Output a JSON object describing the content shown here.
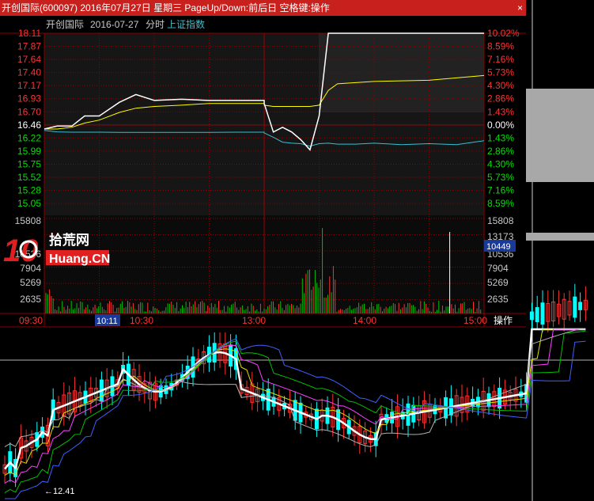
{
  "title_bar": {
    "text": "开创国际(600097) 2016年07月27日 星期三 PageUp/Down:前后日 空格键:操作",
    "close_glyph": "×"
  },
  "chart_header": {
    "stock": "开创国际",
    "date": "2016-07-27",
    "mode": "分时",
    "index_link": "上证指数"
  },
  "price_axis": {
    "left_labels": [
      "18.11",
      "17.87",
      "17.64",
      "17.40",
      "17.17",
      "16.93",
      "16.70",
      "16.46",
      "16.22",
      "15.99",
      "15.75",
      "15.52",
      "15.28",
      "15.05"
    ],
    "right_labels": [
      "10.02%",
      "8.59%",
      "7.16%",
      "5.73%",
      "4.30%",
      "2.86%",
      "1.43%",
      "0.00%",
      "1.43%",
      "2.86%",
      "4.30%",
      "5.73%",
      "7.16%",
      "8.59%"
    ]
  },
  "volume_axis": {
    "left_labels": [
      "15808",
      "10536",
      "7904",
      "5269",
      "2635"
    ],
    "right_labels": [
      "15808",
      "13173",
      "10536",
      "7904",
      "5269",
      "2635"
    ],
    "current_value": "10449"
  },
  "time_axis": {
    "labels": [
      "09:30",
      "10:30",
      "13:00",
      "14:00",
      "15:00"
    ],
    "cursor": "10:11",
    "action": "操作"
  },
  "watermark": {
    "brand_digits": "10",
    "brand_cn": "拾荒网",
    "brand_en": "Huang.CN"
  },
  "kline_panel": {
    "low_annotation": "←12.41"
  },
  "colors": {
    "up": "#ff3232",
    "down": "#00ffff",
    "price_line": "#ffffff",
    "avg_line": "#ffff00",
    "index_line": "#35c0d0",
    "grid": "#8b0000",
    "axis_red": "#ff3232",
    "axis_green": "#00e000",
    "volume": "#ffff50",
    "ma_magenta": "#ff40ff",
    "ma_yellow": "#e0e000",
    "ma_green": "#00c000",
    "ma_blue": "#4060ff",
    "ma_white": "#ffffff",
    "ma_gray": "#b0b0b0"
  },
  "chart_data": {
    "type": "line",
    "x": [
      "09:30",
      "09:37",
      "09:45",
      "09:52",
      "10:00",
      "10:11",
      "10:20",
      "10:30",
      "10:45",
      "11:00",
      "11:15",
      "11:30",
      "13:00",
      "13:05",
      "13:10",
      "13:15",
      "13:20",
      "13:25",
      "13:30",
      "13:35",
      "13:40",
      "13:50",
      "14:00",
      "14:15",
      "14:30",
      "14:45",
      "15:00"
    ],
    "series": [
      {
        "role": "price",
        "values": [
          16.5,
          16.55,
          16.55,
          16.72,
          16.72,
          16.95,
          17.08,
          16.98,
          17.0,
          16.98,
          16.98,
          16.98,
          16.93,
          16.45,
          16.53,
          16.45,
          16.32,
          16.15,
          16.72,
          18.11,
          18.11,
          18.11,
          18.11,
          18.11,
          18.11,
          18.11,
          18.11
        ]
      },
      {
        "role": "average",
        "values": [
          16.5,
          16.5,
          16.53,
          16.6,
          16.65,
          16.78,
          16.85,
          16.88,
          16.9,
          16.93,
          16.93,
          16.93,
          16.9,
          16.88,
          16.88,
          16.88,
          16.88,
          16.88,
          16.9,
          17.15,
          17.26,
          17.28,
          17.3,
          17.31,
          17.32,
          17.36,
          17.4
        ]
      },
      {
        "role": "index",
        "values": [
          0.1,
          -0.05,
          -0.08,
          -0.08,
          -0.08,
          -0.1,
          -0.1,
          -0.1,
          -0.1,
          -0.1,
          -0.08,
          -0.08,
          -0.15,
          -0.6,
          -1.1,
          -1.2,
          -1.25,
          -1.5,
          -1.25,
          -1.2,
          -1.3,
          -1.3,
          -1.2,
          -1.35,
          -1.25,
          -1.35,
          -0.95
        ]
      }
    ],
    "ylim": [
      15.05,
      18.11
    ],
    "volume_ylim": [
      0,
      15808
    ]
  }
}
